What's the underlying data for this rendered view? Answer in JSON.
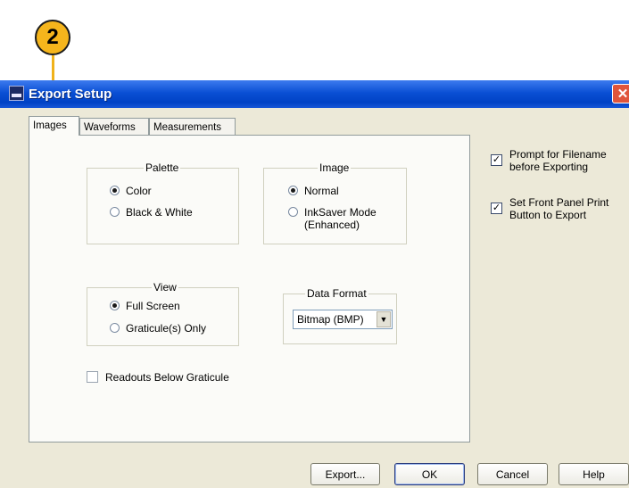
{
  "callout": {
    "number": "2"
  },
  "window": {
    "title": "Export Setup",
    "close_glyph": "✕"
  },
  "tabs": [
    {
      "label": "Images",
      "active": true
    },
    {
      "label": "Waveforms",
      "active": false
    },
    {
      "label": "Measurements",
      "active": false
    }
  ],
  "palette": {
    "title": "Palette",
    "options": [
      {
        "label": "Color",
        "selected": true
      },
      {
        "label": "Black & White",
        "selected": false
      }
    ]
  },
  "image": {
    "title": "Image",
    "options": [
      {
        "label": "Normal",
        "selected": true
      },
      {
        "label": "InkSaver Mode (Enhanced)",
        "selected": false
      }
    ]
  },
  "view": {
    "title": "View",
    "options": [
      {
        "label": "Full Screen",
        "selected": true
      },
      {
        "label": "Graticule(s) Only",
        "selected": false
      }
    ]
  },
  "data_format": {
    "title": "Data Format",
    "value": "Bitmap (BMP)"
  },
  "readouts": {
    "label": "Readouts Below Graticule",
    "checked": false
  },
  "right_options": [
    {
      "label": "Prompt for Filename before Exporting",
      "checked": true
    },
    {
      "label": "Set Front Panel Print Button to Export",
      "checked": true
    }
  ],
  "buttons": {
    "export": "Export...",
    "ok": "OK",
    "cancel": "Cancel",
    "help": "Help"
  }
}
